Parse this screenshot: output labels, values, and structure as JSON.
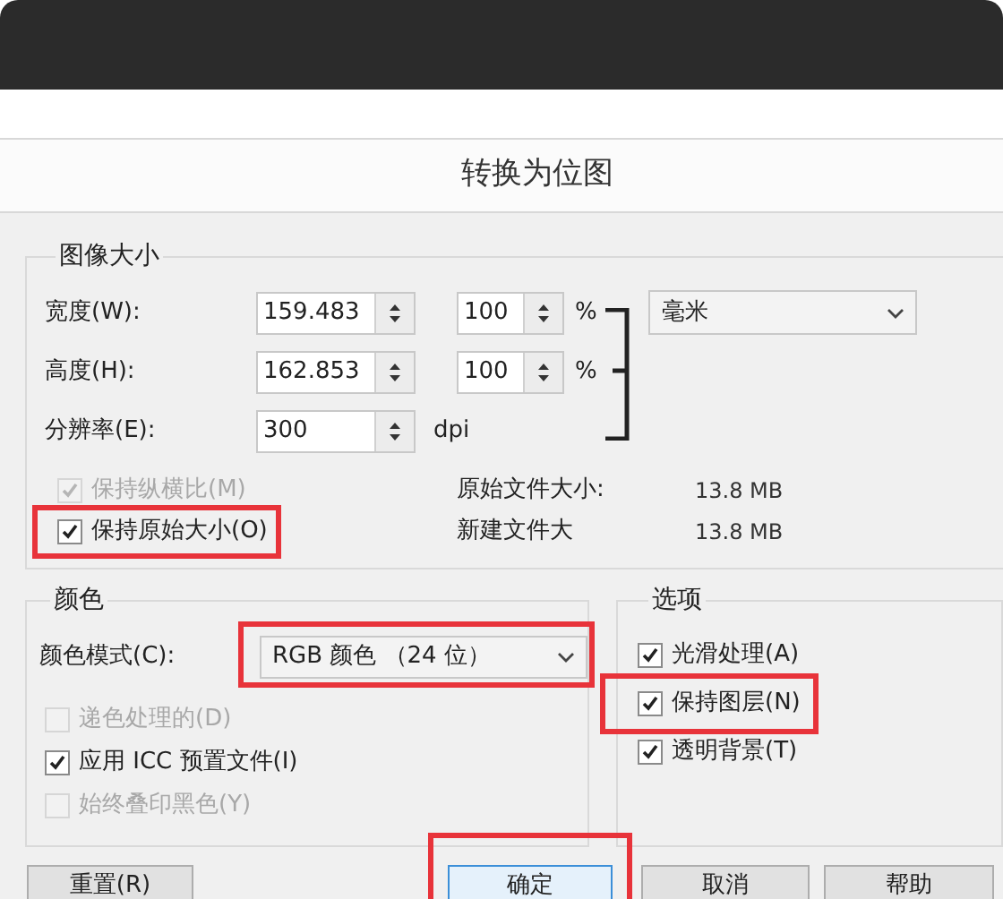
{
  "dialog": {
    "title": "转换为位图"
  },
  "image_size": {
    "legend": "图像大小",
    "fields": [
      {
        "label": "宽度(W):",
        "value": "159.483",
        "percent": "100",
        "percent_unit": "%"
      },
      {
        "label": "高度(H):",
        "value": "162.853",
        "percent": "100",
        "percent_unit": "%"
      },
      {
        "label": "分辨率(E):",
        "value": "300",
        "unit": "dpi"
      }
    ],
    "unit_dropdown": "毫米",
    "checkboxes": [
      {
        "label": "保持纵横比(M)",
        "checked": true,
        "disabled": true,
        "highlighted": false
      },
      {
        "label": "保持原始大小(O)",
        "checked": true,
        "disabled": false,
        "highlighted": true
      }
    ],
    "info": [
      {
        "label": "原始文件大小:",
        "value": "13.8 MB"
      },
      {
        "label": "新建文件大",
        "value": "13.8 MB"
      }
    ]
  },
  "color": {
    "legend": "颜色",
    "mode_label": "颜色模式(C):",
    "mode_value": "RGB 颜色 （24 位）",
    "mode_highlighted": true,
    "checkboxes": [
      {
        "label": "递色处理的(D)",
        "checked": false,
        "disabled": true,
        "highlighted": false
      },
      {
        "label": "应用 ICC 预置文件(I)",
        "checked": true,
        "disabled": false,
        "highlighted": false
      },
      {
        "label": "始终叠印黑色(Y)",
        "checked": false,
        "disabled": true,
        "highlighted": false
      }
    ]
  },
  "options": {
    "legend": "选项",
    "checkboxes": [
      {
        "label": "光滑处理(A)",
        "checked": true,
        "disabled": false,
        "highlighted": false
      },
      {
        "label": "保持图层(N)",
        "checked": true,
        "disabled": false,
        "highlighted": true
      },
      {
        "label": "透明背景(T)",
        "checked": true,
        "disabled": false,
        "highlighted": false
      }
    ]
  },
  "buttons": [
    {
      "label": "重置(R)",
      "default": false,
      "highlighted": false
    },
    {
      "label": "确定",
      "default": true,
      "highlighted": true
    },
    {
      "label": "取消",
      "default": false,
      "highlighted": false
    },
    {
      "label": "帮助",
      "default": false,
      "highlighted": false
    }
  ]
}
